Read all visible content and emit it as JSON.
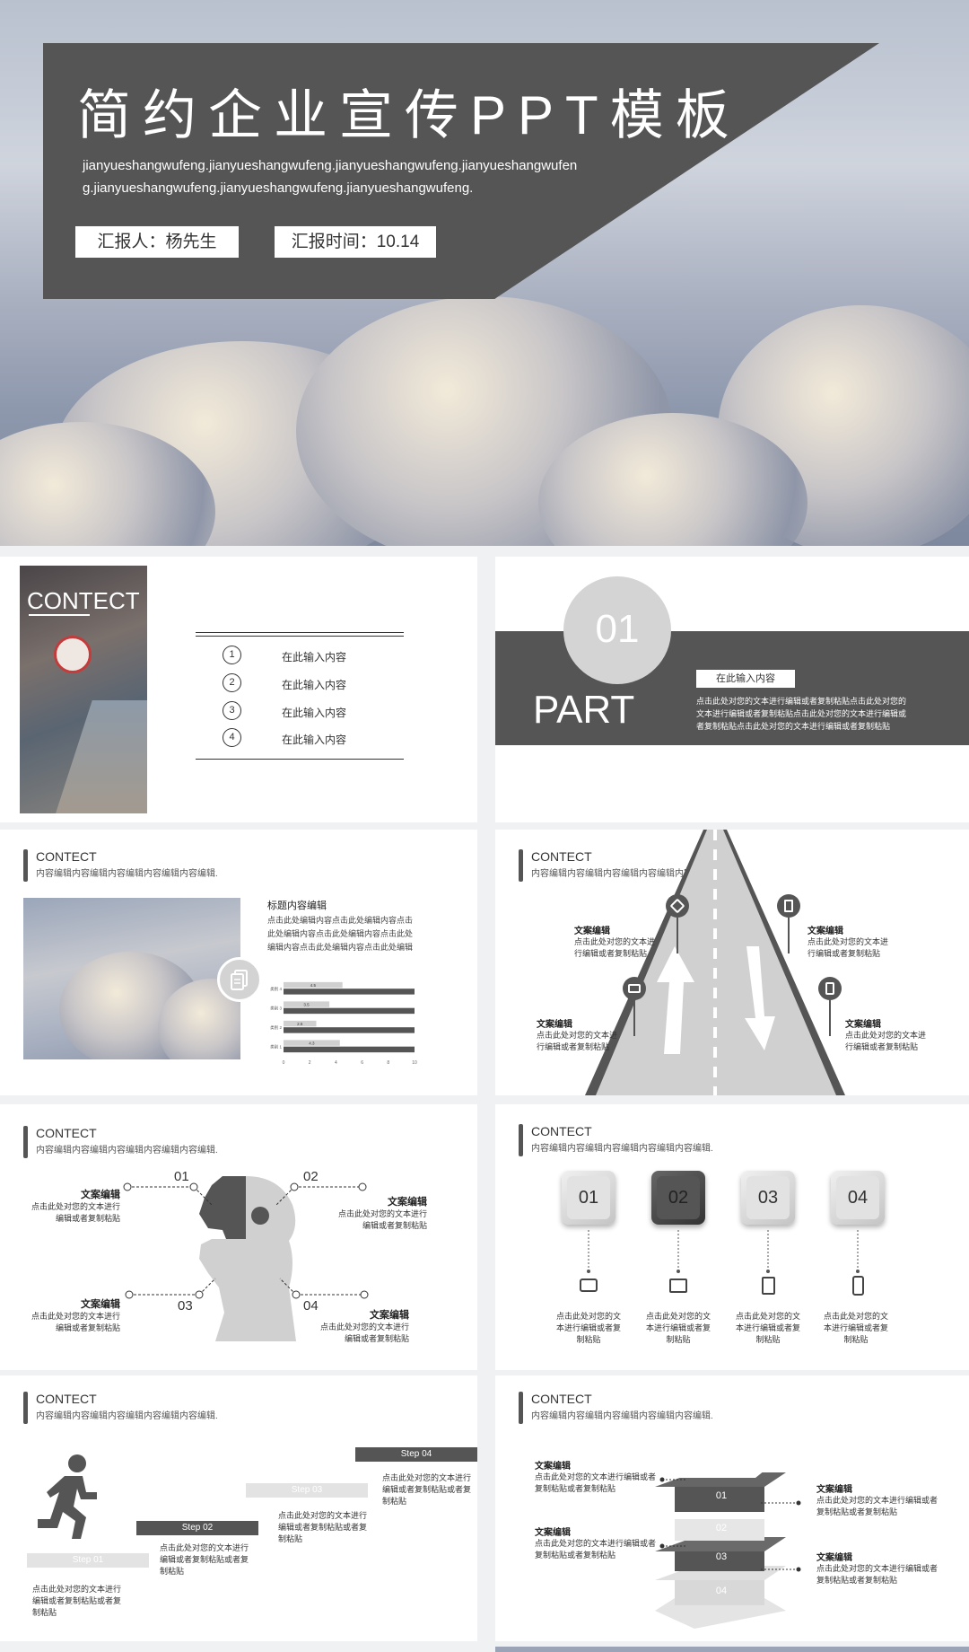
{
  "cover": {
    "title": "简约企业宣传PPT模板",
    "subtitle": "jianyueshangwufeng.jianyueshangwufeng.jianyueshangwufeng.jianyueshangwufeng.jianyueshangwufeng.jianyueshangwufeng.jianyueshangwufeng.",
    "reporter": "汇报人：杨先生",
    "time": "汇报时间：10.14"
  },
  "contents": {
    "title": "CONTECT",
    "items": [
      {
        "num": "1",
        "label": "在此输入内容"
      },
      {
        "num": "2",
        "label": "在此输入内容"
      },
      {
        "num": "3",
        "label": "在此输入内容"
      },
      {
        "num": "4",
        "label": "在此输入内容"
      }
    ]
  },
  "part": {
    "num": "01",
    "word": "PART",
    "box": "在此输入内容",
    "desc": "点击此处对您的文本进行编辑或者复制粘贴点击此处对您的文本进行编辑或者复制粘贴点击此处对您的文本进行编辑或者复制粘贴点击此处对您的文本进行编辑或者复制粘贴"
  },
  "header": {
    "title": "CONTECT",
    "sub": "内容编辑内容编辑内容编辑内容编辑内容编辑."
  },
  "slide_chart": {
    "heading": "标题内容编辑",
    "body": "点击此处编辑内容点击此处编辑内容点击此处编辑内容点击此处编辑内容点击此处编辑内容点击此处编辑内容点击此处编辑"
  },
  "chart_data": {
    "type": "bar",
    "orientation": "horizontal",
    "categories": [
      "类别 4",
      "类别 3",
      "类别 2",
      "类别 1"
    ],
    "series": [
      {
        "values": [
          4.5,
          3.5,
          2.5,
          4.3
        ],
        "color": "#d0d0d0"
      },
      {
        "values": [
          10,
          10,
          10,
          10
        ],
        "color": "#555555"
      }
    ],
    "data_labels": [
      "4.5",
      "3.5",
      "2.5",
      "4.3"
    ],
    "xticks": [
      "0",
      "2",
      "4",
      "6",
      "8",
      "10"
    ],
    "xlim": [
      0,
      10
    ]
  },
  "road": {
    "items": [
      {
        "title": "文案编辑",
        "text": "点击此处对您的文本进行编辑或者复制粘贴"
      },
      {
        "title": "文案编辑",
        "text": "点击此处对您的文本进行编辑或者复制粘贴"
      },
      {
        "title": "文案编辑",
        "text": "点击此处对您的文本进行编辑或者复制粘贴"
      },
      {
        "title": "文案编辑",
        "text": "点击此处对您的文本进行编辑或者复制粘贴"
      }
    ]
  },
  "puzzle": {
    "nums": [
      "01",
      "02",
      "03",
      "04"
    ],
    "items": [
      {
        "title": "文案编辑",
        "text": "点击此处对您的文本进行编辑或者复制粘贴"
      },
      {
        "title": "文案编辑",
        "text": "点击此处对您的文本进行编辑或者复制粘贴"
      },
      {
        "title": "文案编辑",
        "text": "点击此处对您的文本进行编辑或者复制粘贴"
      },
      {
        "title": "文案编辑",
        "text": "点击此处对您的文本进行编辑或者复制粘贴"
      }
    ]
  },
  "buttons": {
    "nums": [
      "01",
      "02",
      "03",
      "04"
    ],
    "texts": [
      "点击此处对您的文本进行编辑或者复制粘贴",
      "点击此处对您的文本进行编辑或者复制粘贴",
      "点击此处对您的文本进行编辑或者复制粘贴",
      "点击此处对您的文本进行编辑或者复制粘贴"
    ]
  },
  "steps": {
    "labels": [
      "Step 01",
      "Step 02",
      "Step 03",
      "Step 04"
    ],
    "texts": [
      "点击此处对您的文本进行编辑或者复制粘贴或者复制粘贴",
      "点击此处对您的文本进行编辑或者复制粘贴或者复制粘贴",
      "点击此处对您的文本进行编辑或者复制粘贴或者复制粘贴",
      "点击此处对您的文本进行编辑或者复制粘贴或者复制粘贴"
    ]
  },
  "layers": {
    "nums": [
      "01",
      "02",
      "03",
      "04"
    ],
    "items": [
      {
        "title": "文案编辑",
        "text": "点击此处对您的文本进行编辑或者复制粘贴或者复制粘贴"
      },
      {
        "title": "文案编辑",
        "text": "点击此处对您的文本进行编辑或者复制粘贴或者复制粘贴"
      },
      {
        "title": "文案编辑",
        "text": "点击此处对您的文本进行编辑或者复制粘贴或者复制粘贴"
      },
      {
        "title": "文案编辑",
        "text": "点击此处对您的文本进行编辑或者复制粘贴或者复制粘贴"
      }
    ]
  }
}
